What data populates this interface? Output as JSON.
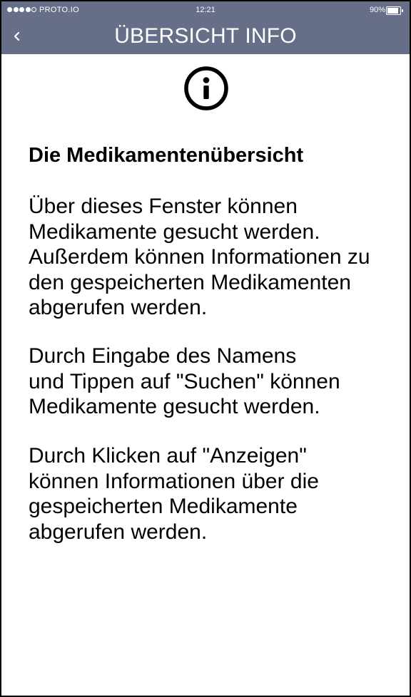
{
  "status_bar": {
    "signal_strength": 4,
    "signal_max": 5,
    "carrier": "PROTO.IO",
    "time": "12:21",
    "battery_percent": "90%",
    "battery_level": 0.9,
    "battery_icon": "battery-icon"
  },
  "nav": {
    "back_icon": "chevron-left-icon",
    "title": "ÜBERSICHT INFO"
  },
  "info_icon": "info-icon",
  "content": {
    "heading": "Die Medikamentenübersicht",
    "paragraphs": [
      {
        "lines": [
          "Über dieses Fenster können",
          "Medikamente gesucht werden.",
          "Außerdem können Informationen zu",
          "den gespeicherten Medikamenten",
          "abgerufen werden."
        ]
      },
      {
        "lines": [
          "Durch Eingabe des Namens",
          "und Tippen auf \"Suchen\" können",
          "Medikamente gesucht werden."
        ]
      },
      {
        "lines": [
          "Durch Klicken auf \"Anzeigen\"",
          "können Informationen über die",
          "gespeicherten Medikamente",
          "abgerufen werden."
        ]
      }
    ]
  },
  "colors": {
    "header_background": "#666e88",
    "header_text": "#ffffff",
    "body_text": "#000000",
    "background": "#ffffff",
    "frame": "#000000"
  }
}
